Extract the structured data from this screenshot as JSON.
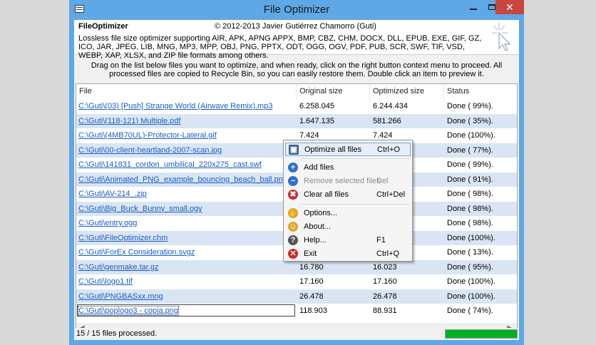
{
  "window": {
    "title": "File Optimizer",
    "min_icon": "minimize-icon",
    "max_icon": "maximize-icon",
    "close_icon": "close-icon",
    "close_glyph": "✕"
  },
  "header": {
    "app_name": "FileOptimizer",
    "copyright": "© 2012-2013 Javier Gutiérrez Chamorro (Guti)",
    "description": "Lossless file size optimizer supporting AIR, APK, APNG APPX, BMP, CBZ, CHM, DOCX, DLL, EPUB, EXE, GIF, GZ, ICO, JAR, JPEG, LIB, MNG, MP3, MPP, OBJ, PNG, PPTX, ODT, OGG, OGV, PDF, PUB, SCR, SWF, TIF, VSD, WEBP, XAP, XLSX, and ZIP file formats among others."
  },
  "instructions": "Drag on the list below files you want to optimize, and when ready, click on the right button context menu to proceed. All processed files are copied to Recycle Bin, so you can easily restore them. Double click an item to preview it.",
  "columns": {
    "file": "File",
    "original": "Original size",
    "optimized": "Optimized size",
    "status": "Status"
  },
  "rows": [
    {
      "file": "C:\\Guti\\(03) [Push] Strange World (Airwave Remix).mp3",
      "original": "6.258.045",
      "optimized": "6.244.434",
      "status": "Done ( 99%)."
    },
    {
      "file": "C:\\Guti\\(118-121) Multiple.pdf",
      "original": "1.647.135",
      "optimized": "581.266",
      "status": "Done ( 35%)."
    },
    {
      "file": "C:\\Guti\\(4MB70UL)-Protector-Lateral.gif",
      "original": "7.424",
      "optimized": "7.424",
      "status": "Done (100%)."
    },
    {
      "file": "C:\\Guti\\00-client-heartland-2007-scan.jpg",
      "original": "",
      "optimized": "",
      "status": "Done ( 77%)."
    },
    {
      "file": "C:\\Guti\\141831_cordon_umbilical_220x275_cast.swf",
      "original": "",
      "optimized": "",
      "status": "Done ( 99%)."
    },
    {
      "file": "C:\\Guti\\Animated_PNG_example_bouncing_beach_ball.png",
      "original": "",
      "optimized": "",
      "status": "Done ( 91%)."
    },
    {
      "file": "C:\\Guti\\AV-214_.zip",
      "original": "",
      "optimized": "",
      "status": "Done ( 98%)."
    },
    {
      "file": "C:\\Guti\\Big_Buck_Bunny_small.ogv",
      "original": "",
      "optimized": "",
      "status": "Done ( 98%)."
    },
    {
      "file": "C:\\Guti\\entry.ogg",
      "original": "",
      "optimized": "",
      "status": "Done ( 98%)."
    },
    {
      "file": "C:\\Guti\\FileOptimizer.chm",
      "original": "",
      "optimized": "",
      "status": "Done (100%)."
    },
    {
      "file": "C:\\Guti\\ForEx Consideration.svgz",
      "original": "",
      "optimized": "",
      "status": "Done ( 13%)."
    },
    {
      "file": "C:\\Guti\\genmake.tar.gz",
      "original": "16.780",
      "optimized": "16.023",
      "status": "Done ( 95%)."
    },
    {
      "file": "C:\\Guti\\logo1.tif",
      "original": "17.160",
      "optimized": "17.160",
      "status": "Done (100%)."
    },
    {
      "file": "C:\\Guti\\PNGBASxx.mng",
      "original": "26.478",
      "optimized": "26.478",
      "status": "Done (100%)."
    },
    {
      "file": "C:\\Guti\\poplogo3 - copia.png",
      "original": "118.903",
      "optimized": "88.931",
      "status": "Done ( 74%)."
    }
  ],
  "status": {
    "text": "15 / 15 files processed.",
    "progress": 1.0,
    "progress_color": "#06b025"
  },
  "context_menu": [
    {
      "label": "Optimize all files",
      "shortcut": "Ctrl+O",
      "icon": "optimize-icon",
      "glyph": "▣",
      "color": "#3c5a8a",
      "highlighted": true,
      "disabled": false
    },
    {
      "label": "Add files",
      "shortcut": "",
      "icon": "add-icon",
      "glyph": "+",
      "color": "#2f6fd1",
      "highlighted": false,
      "disabled": false
    },
    {
      "label": "Remove selected files",
      "shortcut": "Del",
      "icon": "remove-icon",
      "glyph": "−",
      "color": "#2f6fd1",
      "highlighted": false,
      "disabled": true
    },
    {
      "label": "Clear all files",
      "shortcut": "Ctrl+Del",
      "icon": "clear-icon",
      "glyph": "✖",
      "color": "#d02a2a",
      "highlighted": false,
      "disabled": false
    },
    {
      "label": "Options...",
      "shortcut": "",
      "icon": "options-icon",
      "glyph": "✋",
      "color": "#d8a825",
      "highlighted": false,
      "disabled": false
    },
    {
      "label": "About...",
      "shortcut": "",
      "icon": "about-icon",
      "glyph": "☺",
      "color": "#d8a825",
      "highlighted": false,
      "disabled": false
    },
    {
      "label": "Help...",
      "shortcut": "F1",
      "icon": "help-icon",
      "glyph": "?",
      "color": "#555555",
      "highlighted": false,
      "disabled": false
    },
    {
      "label": "Exit",
      "shortcut": "Ctrl+Q",
      "icon": "exit-icon",
      "glyph": "✕",
      "color": "#d02a2a",
      "highlighted": false,
      "disabled": false
    }
  ]
}
